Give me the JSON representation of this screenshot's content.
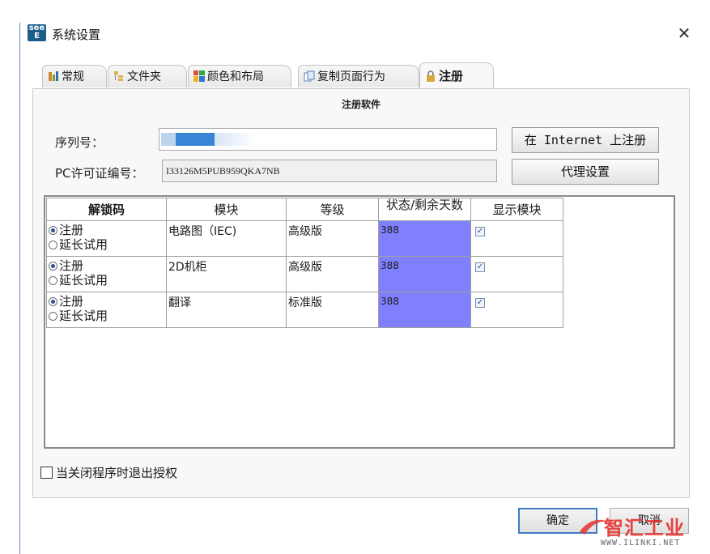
{
  "window": {
    "title": "系统设置",
    "app_icon_top": "see",
    "app_icon_bottom": "E",
    "close_glyph": "✕"
  },
  "tabs": [
    {
      "label": "常规",
      "icon": "settings-icon",
      "active": false
    },
    {
      "label": "文件夹",
      "icon": "folder-tree-icon",
      "active": false
    },
    {
      "label": "颜色和布局",
      "icon": "color-layout-icon",
      "active": false
    },
    {
      "label": "复制页面行为",
      "icon": "copy-page-icon",
      "active": false
    },
    {
      "label": "注册",
      "icon": "lock-icon",
      "active": true
    }
  ],
  "register": {
    "section_title": "注册软件",
    "serial_label": "序列号：",
    "serial_value": "",
    "pc_license_label": "PC许可证编号：",
    "pc_license_value": "I33126M5PUB959QKA7NB",
    "internet_register_button": "在 Internet 上注册",
    "proxy_button": "代理设置"
  },
  "grid": {
    "headers": [
      "解锁码",
      "模块",
      "等级",
      "状态/剩余天数",
      "显示模块"
    ],
    "rows": [
      {
        "unlock_register": "注册",
        "unlock_extend": "延长试用",
        "module": "电路图（IEC)",
        "level": "高级版",
        "status": "388",
        "show": true
      },
      {
        "unlock_register": "注册",
        "unlock_extend": "延长试用",
        "module": "2D机柜",
        "level": "高级版",
        "status": "388",
        "show": true
      },
      {
        "unlock_register": "注册",
        "unlock_extend": "延长试用",
        "module": "翻译",
        "level": "标准版",
        "status": "388",
        "show": true
      }
    ]
  },
  "exit_on_close": {
    "label": "当关闭程序时退出授权",
    "checked": false
  },
  "footer": {
    "ok": "确定",
    "cancel": "取消"
  },
  "watermark": {
    "text": "智汇工业",
    "url": "WWW.ILINKI.NET"
  },
  "colors": {
    "status_cell": "#8080ff",
    "serial_mask": "#3a84d6",
    "accent_border": "#3d7bc2"
  }
}
